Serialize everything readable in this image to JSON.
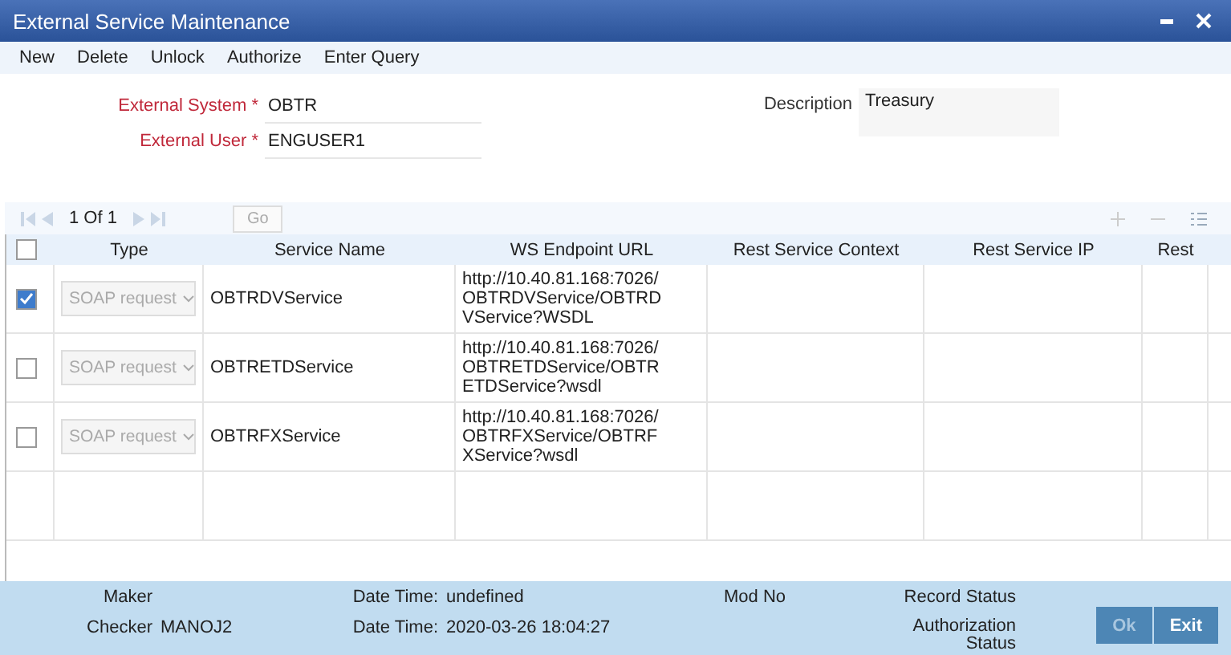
{
  "window": {
    "title": "External Service Maintenance"
  },
  "menu": [
    "New",
    "Delete",
    "Unlock",
    "Authorize",
    "Enter Query"
  ],
  "form": {
    "external_system": {
      "label": "External System",
      "required": true,
      "required_mark": "*",
      "value": "OBTR"
    },
    "external_user": {
      "label": "External User",
      "required": true,
      "required_mark": "*",
      "value": "ENGUSER1"
    },
    "description": {
      "label": "Description",
      "value": "Treasury"
    }
  },
  "pager": {
    "text": "1 Of 1",
    "go": "Go"
  },
  "table": {
    "select_all": false,
    "columns": [
      "Type",
      "Service Name",
      "WS Endpoint URL",
      "Rest Service Context",
      "Rest Service IP",
      "Rest"
    ],
    "rows": [
      {
        "checked": true,
        "type": "SOAP request",
        "type_disabled": true,
        "service_name": "OBTRDVService",
        "url": "http://10.40.81.168:7026/\nOBTRDVService/OBTRD\nVService?WSDL"
      },
      {
        "checked": false,
        "type": "SOAP request",
        "type_disabled": true,
        "service_name": "OBTRETDService",
        "url": "http://10.40.81.168:7026/\nOBTRETDService/OBTR\nETDService?wsdl"
      },
      {
        "checked": false,
        "type": "SOAP request",
        "type_disabled": true,
        "service_name": "OBTRFXService",
        "url": "http://10.40.81.168:7026/\nOBTRFXService/OBTRF\nXService?wsdl"
      }
    ]
  },
  "footer": {
    "maker": {
      "label": "Maker"
    },
    "checker": {
      "label": "Checker",
      "value": "MANOJ2"
    },
    "maker_date": {
      "label": "Date Time:",
      "value": "undefined"
    },
    "checker_date": {
      "label": "Date Time:",
      "value": "2020-03-26 18:04:27"
    },
    "mod_no": {
      "label": "Mod No"
    },
    "record_status": {
      "label": "Record Status"
    },
    "authorization_status": {
      "label": "Authorization Status"
    },
    "buttons": [
      {
        "label": "Ok",
        "disabled": true
      },
      {
        "label": "Exit",
        "disabled": false
      }
    ]
  }
}
